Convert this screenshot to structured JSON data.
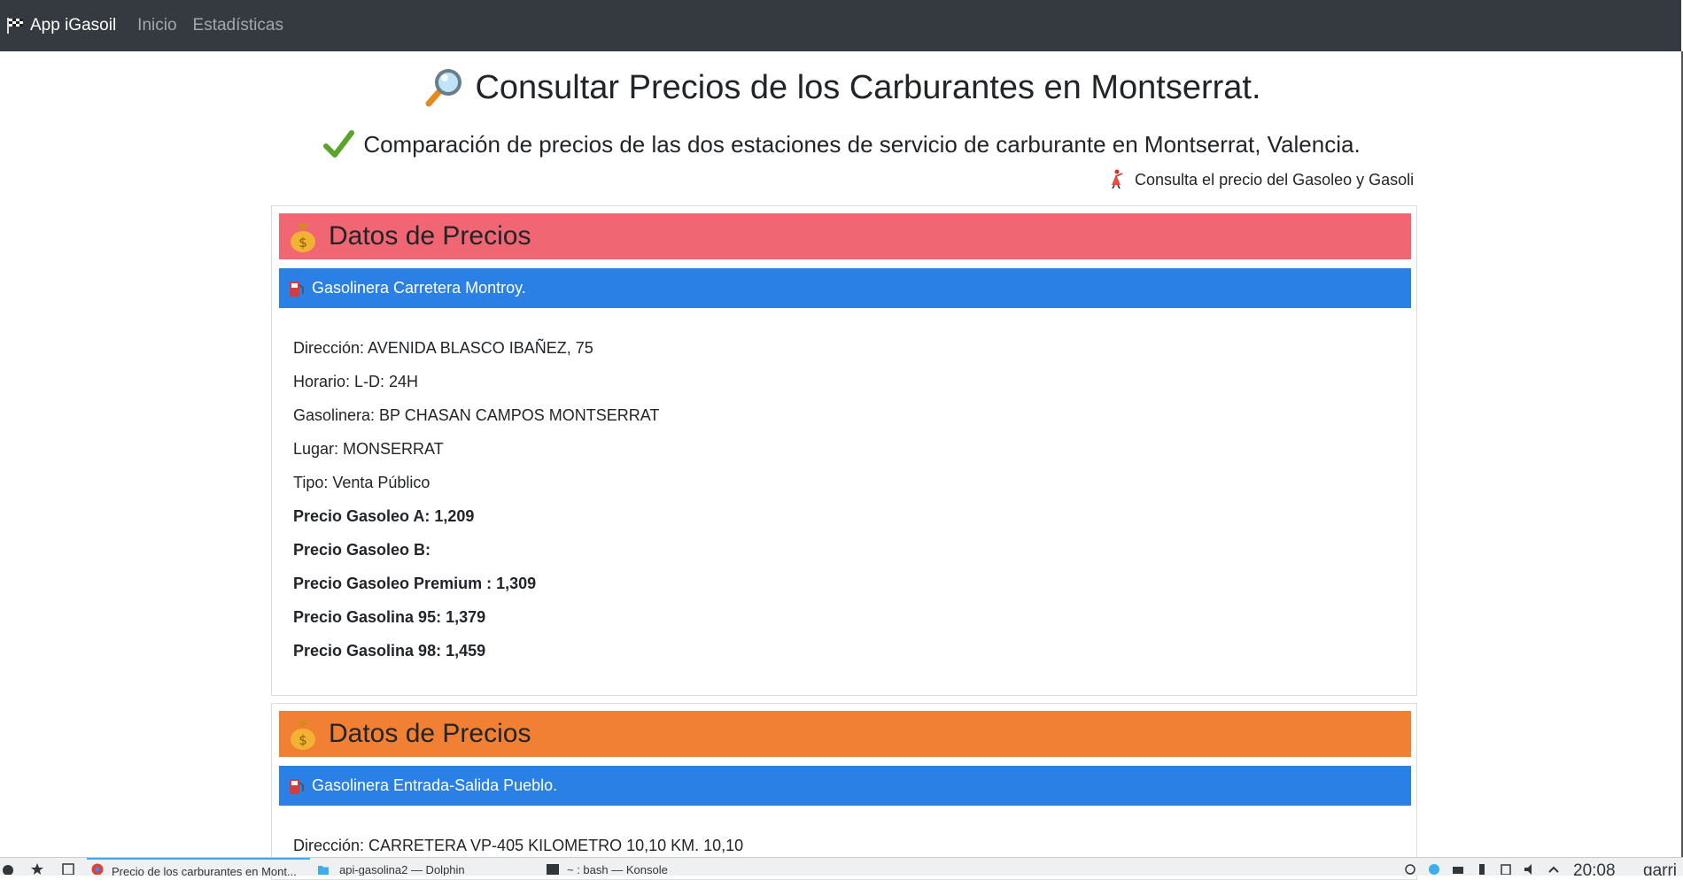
{
  "navbar": {
    "brand": "App iGasoil",
    "brand_icon": "checkered-flag-icon",
    "links": [
      "Inicio",
      "Estadísticas"
    ]
  },
  "main": {
    "title": "Consultar Precios de los Carburantes en Montserrat.",
    "title_icon": "magnifying-glass-icon",
    "subtitle": "Comparación de precios de las dos estaciones de servicio de carburante en Montserrat, Valencia.",
    "subtitle_icon": "check-mark-icon",
    "marquee": "Consulta el precio del Gasoleo y Gasolina",
    "marquee_icon": "dancer-icon"
  },
  "cards": [
    {
      "header": "Datos de Precios",
      "header_icon": "money-bag-icon",
      "header_color": "#f16673",
      "station_name": "Gasolinera Carretera Montroy.",
      "station_icon": "fuel-pump-icon",
      "lines": [
        "Dirección: AVENIDA BLASCO IBAÑEZ, 75",
        "Horario: L-D: 24H",
        "Gasolinera: BP CHASAN CAMPOS MONTSERRAT",
        "Lugar: MONSERRAT",
        "Tipo: Venta Público"
      ],
      "price_lines": [
        "Precio Gasoleo A: 1,209",
        "Precio Gasoleo B:",
        "Precio Gasoleo Premium : 1,309",
        "Precio Gasolina 95: 1,379",
        "Precio Gasolina 98: 1,459"
      ]
    },
    {
      "header": "Datos de Precios",
      "header_icon": "money-bag-icon",
      "header_color": "#f28034",
      "station_name": "Gasolinera Entrada-Salida Pueblo.",
      "station_icon": "fuel-pump-icon",
      "lines": [
        "Dirección: CARRETERA VP-405 KILOMETRO 10,10 KM. 10,10"
      ]
    }
  ],
  "taskbar": {
    "tasks": [
      "Precio de los carburantes en Mont...",
      "api-gasolina2 — Dolphin",
      "~ : bash — Konsole"
    ],
    "clock": "20:08",
    "user": "garri"
  },
  "colors": {
    "navbar_bg": "#343a40",
    "station_bar": "#2a80e4",
    "card1_header": "#f16673",
    "card2_header": "#f28034"
  }
}
